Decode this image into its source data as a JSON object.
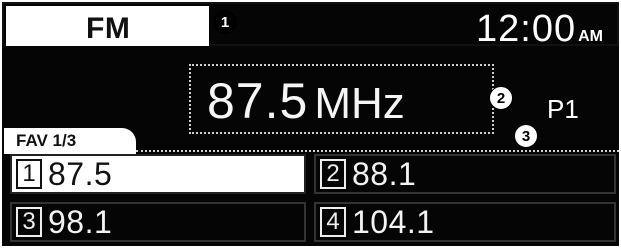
{
  "header": {
    "band": "FM",
    "time": "12:00",
    "ampm": "AM",
    "callout": "1"
  },
  "tuner": {
    "frequency": "87.5",
    "unit": "MHz",
    "preset_id": "P1",
    "callout": "2"
  },
  "favorites": {
    "label": "FAV 1/3",
    "callout": "3",
    "presets": [
      {
        "number": "1",
        "value": "87.5"
      },
      {
        "number": "2",
        "value": "88.1"
      },
      {
        "number": "3",
        "value": "98.1"
      },
      {
        "number": "4",
        "value": "104.1"
      }
    ]
  }
}
